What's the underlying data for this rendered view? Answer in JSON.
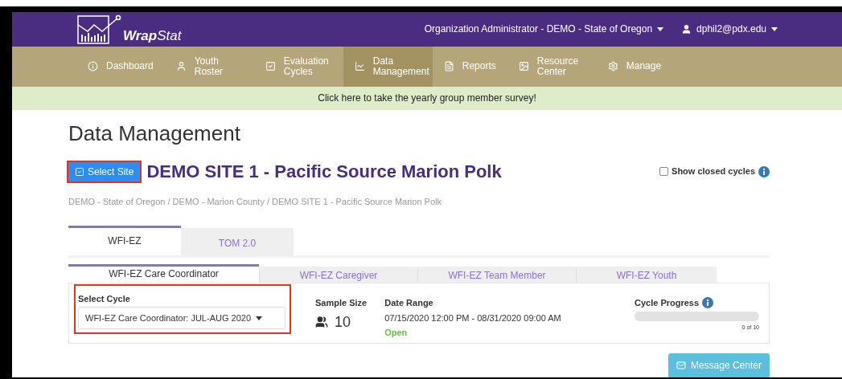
{
  "header": {
    "logo_text": "**Wrap**Stat",
    "org_menu": "Organization Administrator - DEMO - State of Oregon",
    "user_menu": "dphil2@pdx.edu"
  },
  "nav": [
    {
      "kind": "dashboard",
      "label": "Dashboard",
      "selected": false
    },
    {
      "kind": "user",
      "label": "Youth Roster",
      "selected": false
    },
    {
      "kind": "check",
      "label": "Evaluation Cycles",
      "selected": false
    },
    {
      "kind": "chart",
      "label": "Data Management",
      "selected": true
    },
    {
      "kind": "file",
      "label": "Reports",
      "selected": false
    },
    {
      "kind": "image",
      "label": "Resource Center",
      "selected": false
    },
    {
      "kind": "gear",
      "label": "Manage",
      "selected": false
    }
  ],
  "banner": "Click here to take the yearly group member survey!",
  "page_title": "Data Management",
  "select_site": {
    "label": "Select Site",
    "highlighted": true
  },
  "site_name": "DEMO SITE 1 - Pacific Source Marion Polk",
  "show_closed": {
    "label": "Show closed cycles",
    "checked": false
  },
  "breadcrumb": "DEMO - State of Oregon / DEMO - Marion County / DEMO SITE 1 - Pacific Source Marion Polk",
  "tabs": [
    {
      "label": "WFI-EZ",
      "selected": true
    },
    {
      "label": "TOM 2.0",
      "selected": false
    }
  ],
  "subtabs": [
    {
      "label": "WFI-EZ Care Coordinator",
      "selected": true
    },
    {
      "label": "WFI-EZ Caregiver",
      "selected": false
    },
    {
      "label": "WFI-EZ Team Member",
      "selected": false
    },
    {
      "label": "WFI-EZ Youth",
      "selected": false
    }
  ],
  "cycle": {
    "label": "Select Cycle",
    "value": "WFI-EZ Care Coordinator: JUL-AUG 2020",
    "highlighted": true
  },
  "sample": {
    "label": "Sample Size",
    "value": "10"
  },
  "date_range": {
    "label": "Date Range",
    "value": "07/15/2020 12:00 PM - 08/31/2020 09:00 AM",
    "status": "Open"
  },
  "progress": {
    "label": "Cycle Progress",
    "level": 0,
    "reading": "0 of 10"
  },
  "message_center": "Message Center"
}
